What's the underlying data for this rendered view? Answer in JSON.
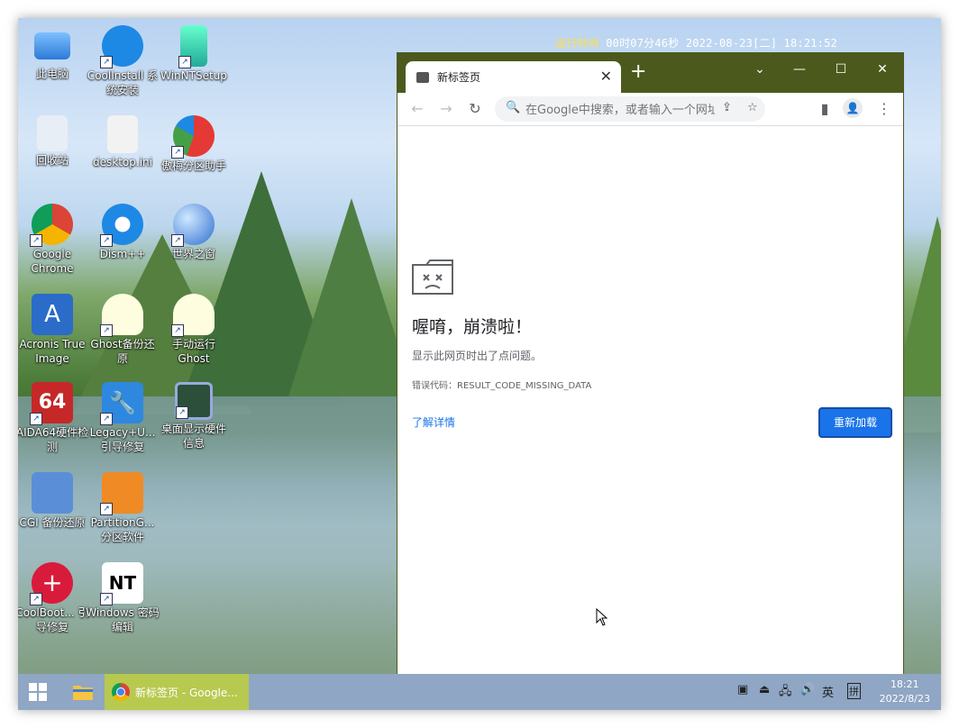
{
  "status_bar": {
    "label": "运行时间",
    "value": "00时07分46秒 2022-08-23[二] 18:21:52"
  },
  "desktop_icons": [
    {
      "label": "此电脑"
    },
    {
      "label": "CoolInstall 系统安装"
    },
    {
      "label": "WinNTSetup"
    },
    {
      "label": "回收站"
    },
    {
      "label": "desktop.ini"
    },
    {
      "label": "傲梅分区助手"
    },
    {
      "label": "Google Chrome"
    },
    {
      "label": "Dism++"
    },
    {
      "label": "世界之窗"
    },
    {
      "label": "Acronis True Image"
    },
    {
      "label": "Ghost备份还原"
    },
    {
      "label": "手动运行 Ghost"
    },
    {
      "label": "AIDA64硬件检测"
    },
    {
      "label": "Legacy+U... 引导修复"
    },
    {
      "label": "桌面显示硬件信息"
    },
    {
      "label": "CGI 备份还原"
    },
    {
      "label": "PartitionG... 分区软件"
    },
    {
      "label": "CoolBoot... 引导修复"
    },
    {
      "label": "Windows 密码编辑"
    }
  ],
  "browser": {
    "tab_title": "新标签页",
    "new_tab": "+",
    "omnibox_placeholder": "在Google中搜索，或者输入一个网址",
    "error_heading": "喔唷，崩溃啦！",
    "error_desc": "显示此网页时出了点问题。",
    "error_code": "错误代码：RESULT_CODE_MISSING_DATA",
    "learn_more": "了解详情",
    "reload": "重新加载"
  },
  "taskbar": {
    "active_task": "新标签页 - Google...",
    "ime": "英",
    "ime2": "拼",
    "time": "18:21",
    "date": "2022/8/23"
  }
}
